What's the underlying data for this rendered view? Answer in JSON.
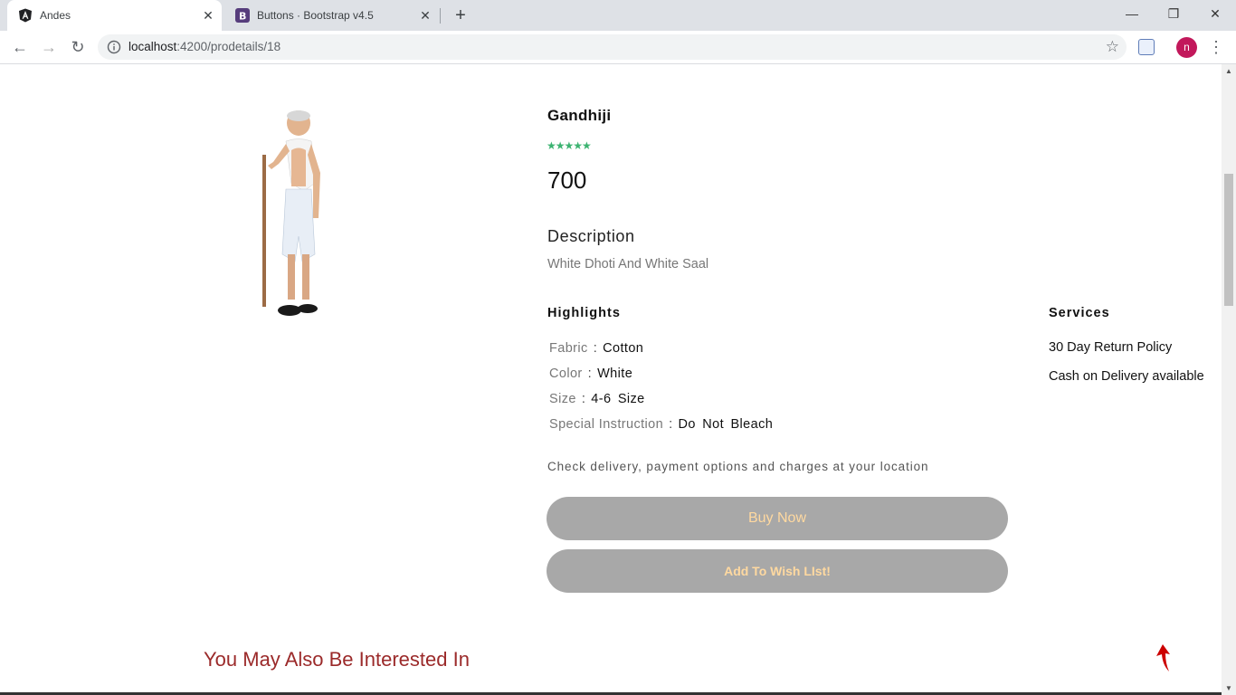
{
  "browser": {
    "tabs": [
      {
        "title": "Andes",
        "favicon": "angular-icon",
        "active": true
      },
      {
        "title": "Buttons · Bootstrap v4.5",
        "favicon": "bootstrap-icon",
        "active": false
      }
    ],
    "new_tab_label": "+",
    "url_host": "localhost",
    "url_path": ":4200/prodetails/18",
    "avatar_letter": "n"
  },
  "product": {
    "name": "Gandhiji",
    "rating_stars": "★★★★★",
    "rating_value": 5,
    "price": "700",
    "description_heading": "Description",
    "description": "White Dhoti And White Saal",
    "highlights_heading": "Highlights",
    "highlights": [
      {
        "label": "Fabric",
        "sep": ":",
        "value": "Cotton"
      },
      {
        "label": "Color",
        "sep": ":",
        "value": "White"
      },
      {
        "label": "Size",
        "sep": ":",
        "value": "4-6 Size"
      },
      {
        "label": "Special Instruction",
        "sep": ":",
        "value": "Do Not Bleach"
      }
    ],
    "services_heading": "Services",
    "services": [
      "30 Day Return Policy",
      "Cash on Delivery available"
    ],
    "delivery_note": "Check delivery, payment options and charges at your location",
    "buy_label": "Buy Now",
    "wish_label": "Add To Wish LIst!"
  },
  "related": {
    "heading": "You May Also Be Interested In"
  },
  "colors": {
    "rating": "#3cb371",
    "button_bg": "#a8a8a8",
    "button_text": "#ffd9a0",
    "related_heading": "#9b2a2a",
    "avatar": "#c2185b"
  }
}
